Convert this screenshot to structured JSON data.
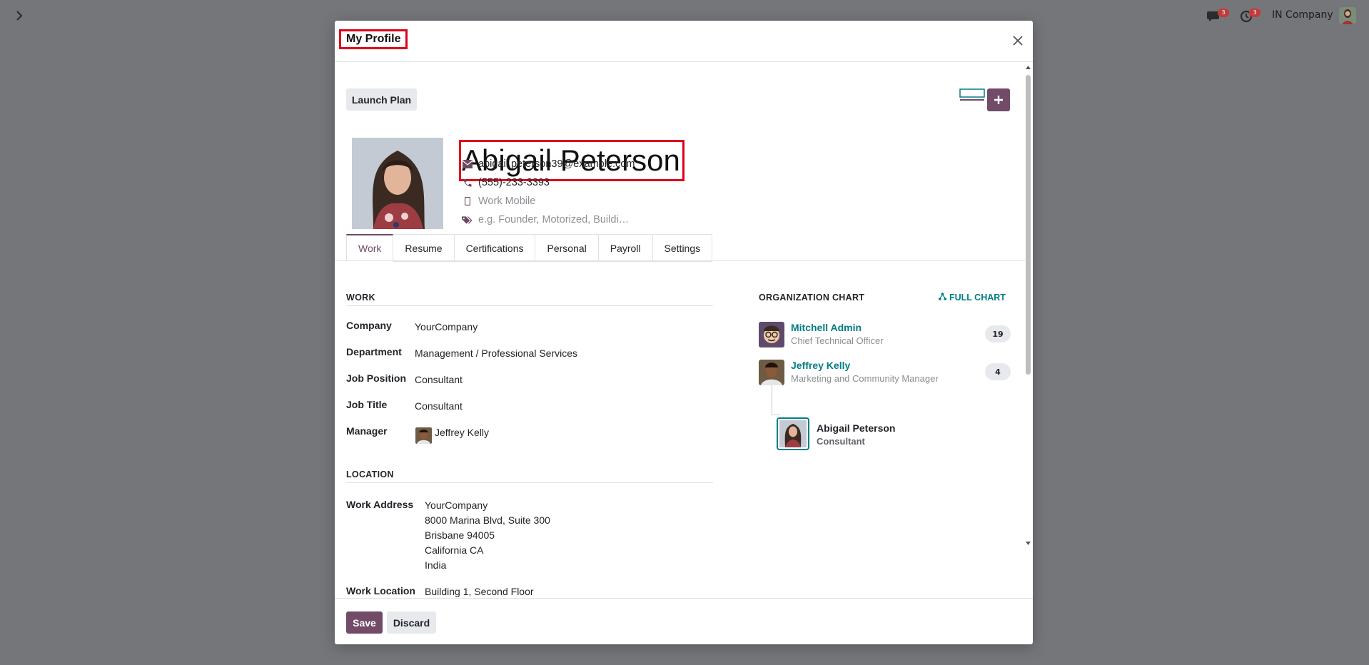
{
  "system": {
    "messages_count": "3",
    "activities_count": "3",
    "company": "IN Company"
  },
  "modal": {
    "title": "My Profile",
    "launch_plan": "Launch Plan",
    "employee": {
      "name": "Abigail Peterson",
      "email": "abigail.peterson39@example.com",
      "phone": "(555)-233-3393",
      "mobile_placeholder": "Work Mobile",
      "tags_placeholder": "e.g. Founder, Motorized, Buildi…"
    },
    "tabs": [
      "Work",
      "Resume",
      "Certifications",
      "Personal",
      "Payroll",
      "Settings"
    ],
    "active_tab": "Work",
    "work": {
      "title": "WORK",
      "fields": [
        {
          "label": "Company",
          "value": "YourCompany"
        },
        {
          "label": "Department",
          "value": "Management / Professional Services"
        },
        {
          "label": "Job Position",
          "value": "Consultant"
        },
        {
          "label": "Job Title",
          "value": "Consultant"
        },
        {
          "label": "Manager",
          "value": "Jeffrey Kelly"
        }
      ]
    },
    "location": {
      "title": "LOCATION",
      "work_address_label": "Work Address",
      "work_address_lines": [
        "YourCompany",
        "8000 Marina Blvd, Suite 300",
        "Brisbane 94005",
        "California CA",
        "India"
      ],
      "work_location_label": "Work Location",
      "work_location": "Building 1, Second Floor"
    },
    "org_chart": {
      "title": "ORGANIZATION CHART",
      "full_chart": "FULL CHART",
      "people": [
        {
          "name": "Mitchell Admin",
          "role": "Chief Technical Officer",
          "count": "19"
        },
        {
          "name": "Jeffrey Kelly",
          "role": "Marketing and Community Manager",
          "count": "4"
        },
        {
          "name": "Abigail Peterson",
          "role": "Consultant"
        }
      ]
    },
    "footer": {
      "save": "Save",
      "discard": "Discard"
    }
  },
  "colors": {
    "primary": "#714b67",
    "link": "#017e84",
    "highlight": "#e0001b"
  }
}
